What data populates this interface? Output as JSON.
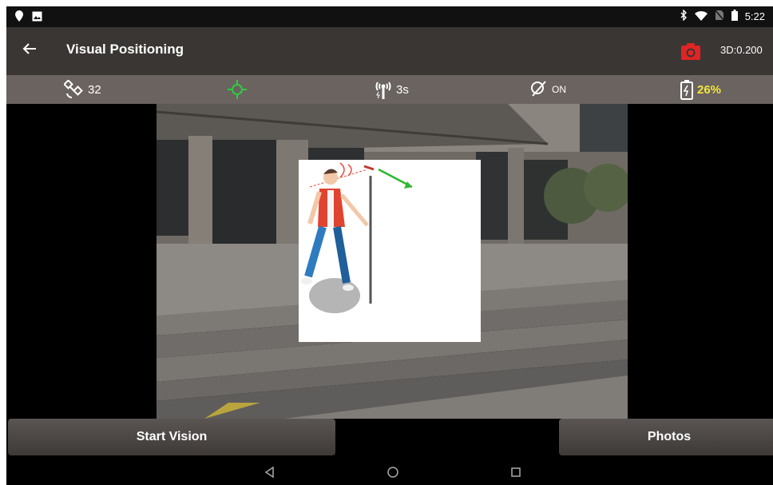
{
  "status_bar": {
    "time": "5:22",
    "left_icons": [
      "location-pin-icon",
      "image-icon"
    ],
    "right_icons": [
      "bluetooth-icon",
      "wifi-icon",
      "no-sim-icon",
      "battery-icon"
    ]
  },
  "header": {
    "back_icon": "arrow-left-icon",
    "title": "Visual Positioning",
    "camera_icon": "camera-icon",
    "camera_icon_color": "#e02424",
    "accuracy": "3D:0.200"
  },
  "info_bar": {
    "satellites": "32",
    "fix_icon_color": "#2ecc40",
    "radio_delay": "3s",
    "tilt_status": "ON",
    "battery": "26%",
    "battery_color": "#f2e63a"
  },
  "buttons": {
    "start_vision": "Start Vision",
    "photos": "Photos"
  },
  "nav": {
    "icons": [
      "nav-back-icon",
      "nav-home-icon",
      "nav-recents-icon"
    ]
  }
}
